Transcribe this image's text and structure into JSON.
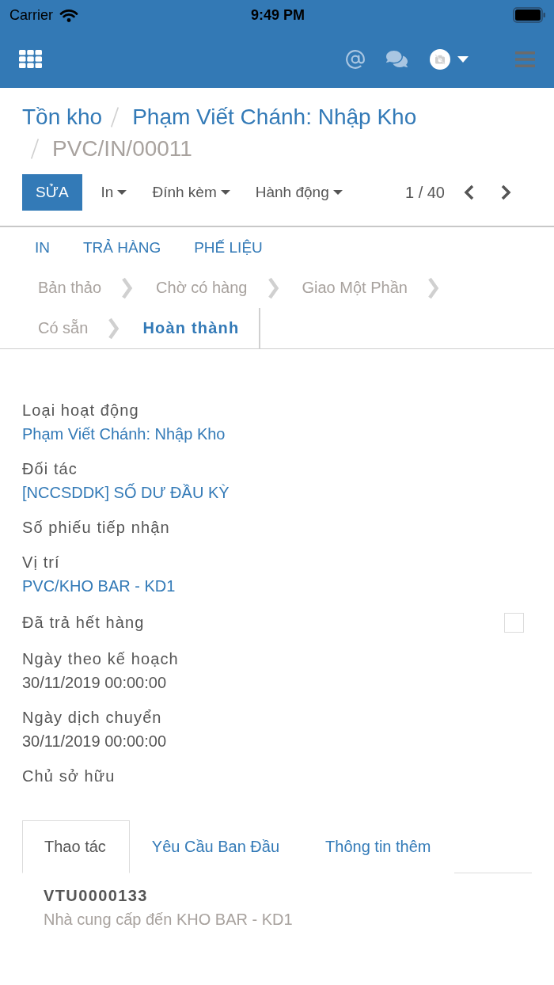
{
  "status_bar": {
    "carrier": "Carrier",
    "time": "9:49 PM"
  },
  "breadcrumb": [
    {
      "label": "Tồn kho",
      "kind": "link"
    },
    {
      "label": "Phạm Viết Chánh: Nhập Kho",
      "kind": "link"
    },
    {
      "label": "PVC/IN/00011",
      "kind": "current"
    }
  ],
  "toolbar": {
    "edit": "SỬA",
    "menus": [
      "In",
      "Đính kèm",
      "Hành động"
    ],
    "pager": "1 / 40"
  },
  "header_buttons": [
    "IN",
    "TRẢ HÀNG",
    "PHẾ LIỆU"
  ],
  "stages": [
    {
      "label": "Bản thảo",
      "selected": false
    },
    {
      "label": "Chờ có hàng",
      "selected": false
    },
    {
      "label": "Giao Một Phần",
      "selected": false
    },
    {
      "label": "Có sẵn",
      "selected": false
    },
    {
      "label": "Hoàn thành",
      "selected": true
    }
  ],
  "fields": [
    {
      "label": "Loại hoạt động",
      "kind": "link",
      "value": "Phạm Viết Chánh: Nhập Kho"
    },
    {
      "label": "Đối tác",
      "kind": "link",
      "value": "[NCCSDDK] SỐ DƯ ĐẦU KỲ"
    },
    {
      "label": "Số phiếu tiếp nhận"
    },
    {
      "label": "Vị trí",
      "kind": "link",
      "value": "PVC/KHO BAR - KD1"
    },
    {
      "label": "Đã trả hết hàng",
      "kind": "checkbox",
      "checked": false
    },
    {
      "label": "Ngày theo kế hoạch",
      "kind": "text",
      "value": "30/11/2019 00:00:00"
    },
    {
      "label": "Ngày dịch chuyển",
      "kind": "text",
      "value": "30/11/2019 00:00:00"
    },
    {
      "label": "Chủ sở hữu"
    }
  ],
  "notebook": {
    "tabs": [
      {
        "label": "Thao tác",
        "selected": true
      },
      {
        "label": "Yêu Cầu Ban Đầu",
        "selected": false
      },
      {
        "label": "Thông tin thêm",
        "selected": false
      }
    ],
    "operations": [
      {
        "product": "VTU0000133",
        "route": "Nhà cung cấp đến KHO BAR - KD1"
      }
    ]
  }
}
